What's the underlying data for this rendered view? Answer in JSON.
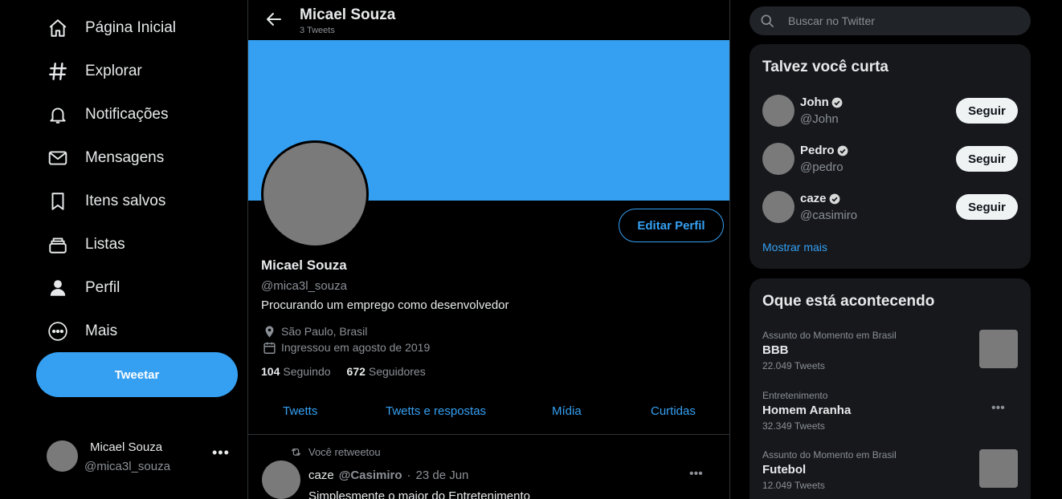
{
  "nav": {
    "items": [
      {
        "label": "Página Inicial",
        "icon": "home-icon"
      },
      {
        "label": "Explorar",
        "icon": "hashtag-icon"
      },
      {
        "label": "Notificações",
        "icon": "bell-icon"
      },
      {
        "label": "Mensagens",
        "icon": "envelope-icon"
      },
      {
        "label": "Itens salvos",
        "icon": "bookmark-icon"
      },
      {
        "label": "Listas",
        "icon": "list-icon"
      },
      {
        "label": "Perfil",
        "icon": "user-icon"
      },
      {
        "label": "Mais",
        "icon": "more-circle-icon"
      }
    ],
    "tweet_button": "Tweetar"
  },
  "account": {
    "name": "Micael Souza",
    "handle": "@mica3l_souza",
    "more": "•••"
  },
  "header": {
    "title": "Micael Souza",
    "subtitle": "3 Tweets"
  },
  "profile": {
    "name": "Micael Souza",
    "handle": "@mica3l_souza",
    "bio": "Procurando um emprego como desenvolvedor",
    "location": "São Paulo, Brasil",
    "joined": "Ingressou em agosto de 2019",
    "following_count": "104",
    "following_label": "Seguindo",
    "followers_count": "672",
    "followers_label": "Seguidores",
    "edit_button": "Editar Perfil",
    "banner_color": "#35a0f2"
  },
  "tabs": [
    "Twetts",
    "Twetts e respostas",
    "Mídia",
    "Curtidas"
  ],
  "tweet": {
    "retweet_label": "Você retweetou",
    "author": "caze",
    "handle": "@Casimiro",
    "separator": "·",
    "date": "23 de Jun",
    "text": "Simplesmente o maior do Entretenimento",
    "more": "•••"
  },
  "search": {
    "placeholder": "Buscar no Twitter"
  },
  "who_to_follow": {
    "title": "Talvez você curta",
    "users": [
      {
        "name": "John",
        "handle": "@John",
        "button": "Seguir"
      },
      {
        "name": "Pedro",
        "handle": "@pedro",
        "button": "Seguir"
      },
      {
        "name": "caze",
        "handle": "@casimiro",
        "button": "Seguir"
      }
    ],
    "show_more": "Mostrar mais"
  },
  "trends": {
    "title": "Oque está acontecendo",
    "items": [
      {
        "context": "Assunto do Momento em Brasil",
        "topic": "BBB",
        "count": "22.049 Tweets"
      },
      {
        "context": "Entretenimento",
        "topic": "Homem Aranha",
        "count": "32.349 Tweets",
        "more": "•••"
      },
      {
        "context": "Assunto do Momento em Brasil",
        "topic": "Futebol",
        "count": "12.049 Tweets"
      }
    ]
  },
  "colors": {
    "accent": "#35a0f2",
    "background": "#000000",
    "card": "#16181c",
    "muted_text": "#8b9096"
  }
}
